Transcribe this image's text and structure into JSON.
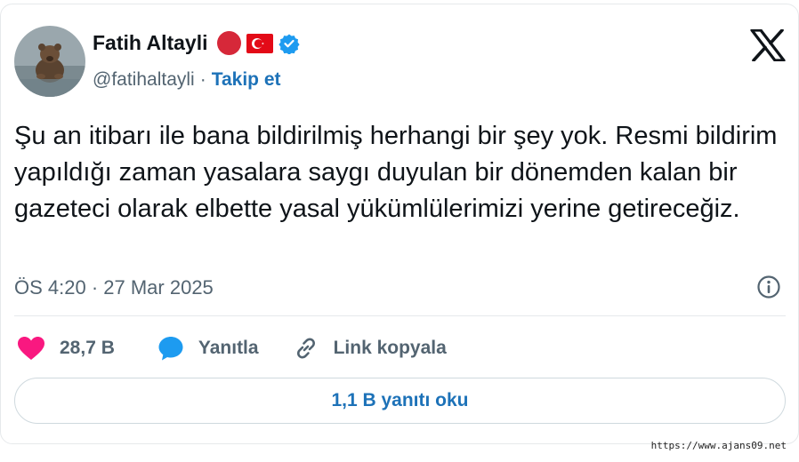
{
  "tweet": {
    "author_name": "Fatih Altayli",
    "handle": "@fatihaltayli",
    "separator": "·",
    "follow_label": "Takip et",
    "text": "Şu an itibarı ile bana bildirilmiş herhangi bir şey yok. Resmi bildirim yapıldığı zaman yasalara saygı duyulan bir dönemden kalan bir gazeteci olarak elbette yasal yükümlülerimizi yerine getireceğiz.",
    "timestamp": "ÖS 4:20 · 27 Mar 2025"
  },
  "actions": {
    "like_count": "28,7 B",
    "reply_label": "Yanıtla",
    "copy_link_label": "Link kopyala"
  },
  "read_replies_label": "1,1 B yanıtı oku",
  "watermark": "https://www.ajans09.net",
  "icons": {
    "close": "x-logo-icon",
    "verified": "verified-badge-icon",
    "flag": "turkey-flag-icon",
    "info": "info-icon",
    "like": "heart-icon",
    "reply": "speech-bubble-icon",
    "link": "link-icon"
  },
  "colors": {
    "accent_blue": "#1d72b8",
    "heart": "#f91880",
    "reply_bubble": "#1d9bf0",
    "muted_text": "#536471"
  }
}
